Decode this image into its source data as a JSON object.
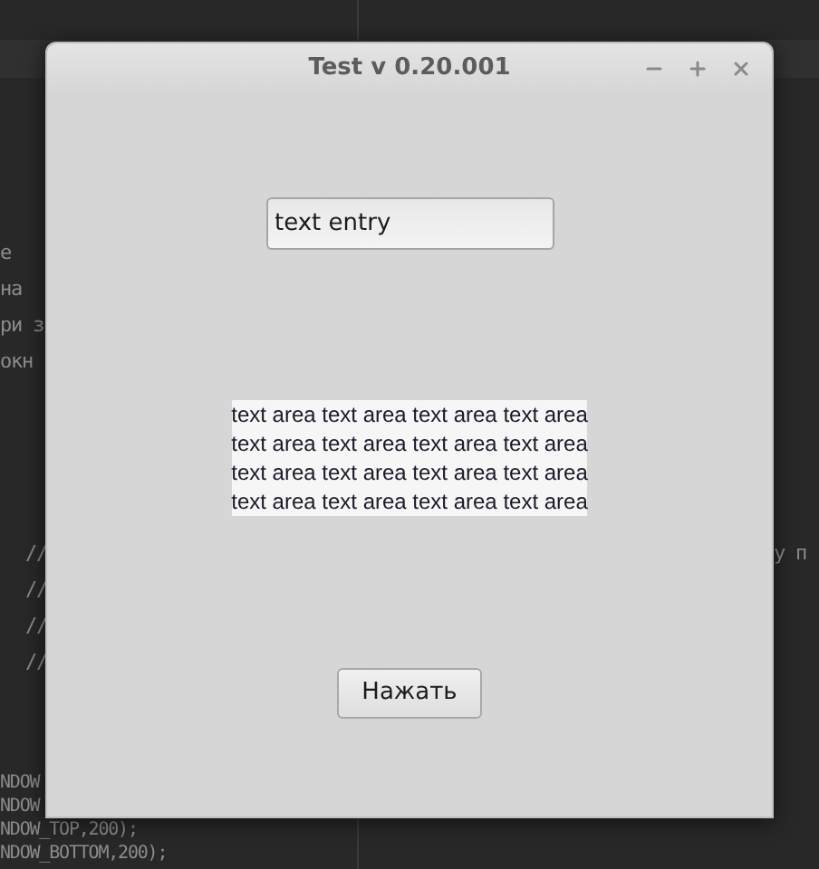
{
  "editor": {
    "left_blocks": [
      [
        "е",
        "на",
        "ри з",
        "окн"
      ],
      [
        "//",
        "//",
        "//",
        "//"
      ],
      [
        "NDOW",
        "NDOW",
        "NDOW_TOP,200);",
        "NDOW_BOTTOM,200);"
      ]
    ],
    "right_lines": [
      "у п"
    ]
  },
  "window": {
    "title": "Test v 0.20.001",
    "text_entry": {
      "value": "text entry"
    },
    "text_area": {
      "lines": [
        "text area text area text area text area",
        "text area text area text area text area",
        "text area text area text area text area",
        "text area text area text area text area"
      ]
    },
    "button": {
      "label": "Нажать"
    }
  }
}
